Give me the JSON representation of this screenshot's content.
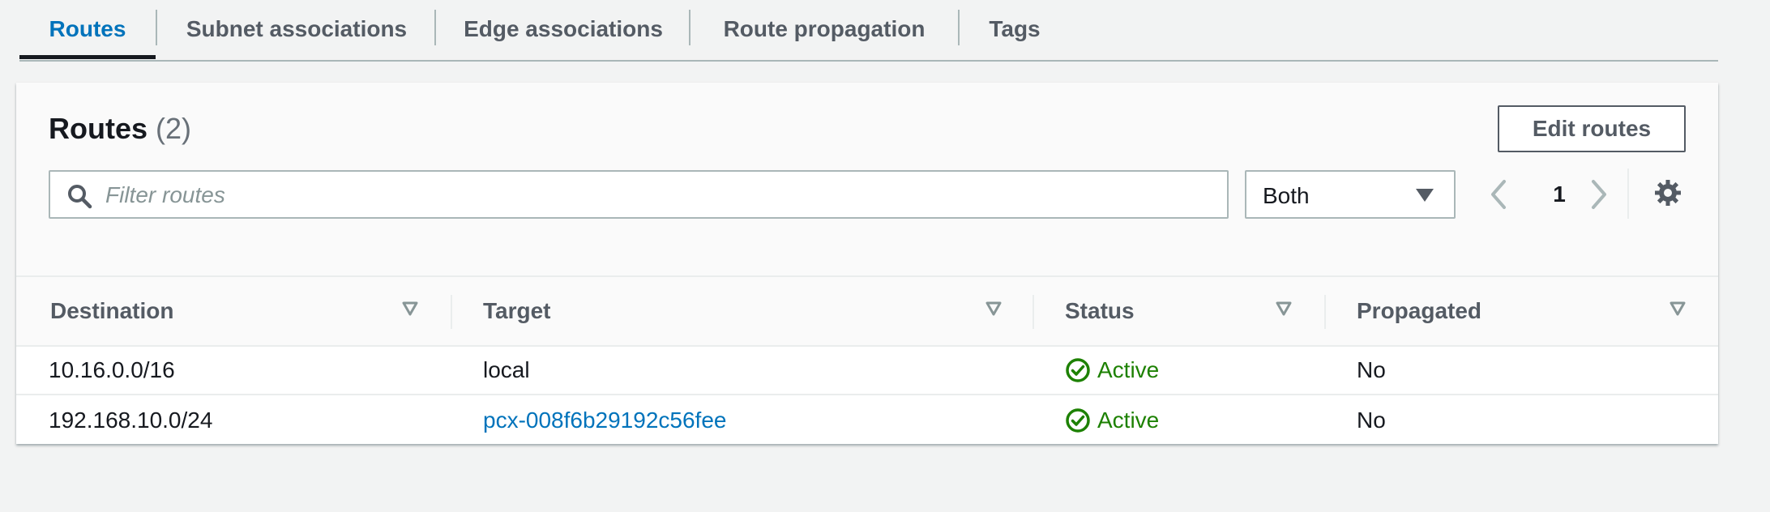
{
  "tabs": [
    {
      "label": "Routes",
      "active": true
    },
    {
      "label": "Subnet associations",
      "active": false
    },
    {
      "label": "Edge associations",
      "active": false
    },
    {
      "label": "Route propagation",
      "active": false
    },
    {
      "label": "Tags",
      "active": false
    }
  ],
  "panel": {
    "title": "Routes",
    "count": "(2)",
    "edit_button": "Edit routes",
    "filter_placeholder": "Filter routes",
    "filter_select": "Both",
    "page": "1"
  },
  "table": {
    "columns": [
      "Destination",
      "Target",
      "Status",
      "Propagated"
    ],
    "rows": [
      {
        "destination": "10.16.0.0/16",
        "target": "local",
        "status": "Active",
        "propagated": "No"
      },
      {
        "destination": "192.168.10.0/24",
        "target": "pcx-008f6b29192c56fee",
        "status": "Active",
        "propagated": "No"
      }
    ]
  },
  "colors": {
    "link": "#0073bb",
    "success": "#1d8102",
    "text": "#16191f",
    "muted": "#545b64",
    "background": "#f2f3f3"
  }
}
